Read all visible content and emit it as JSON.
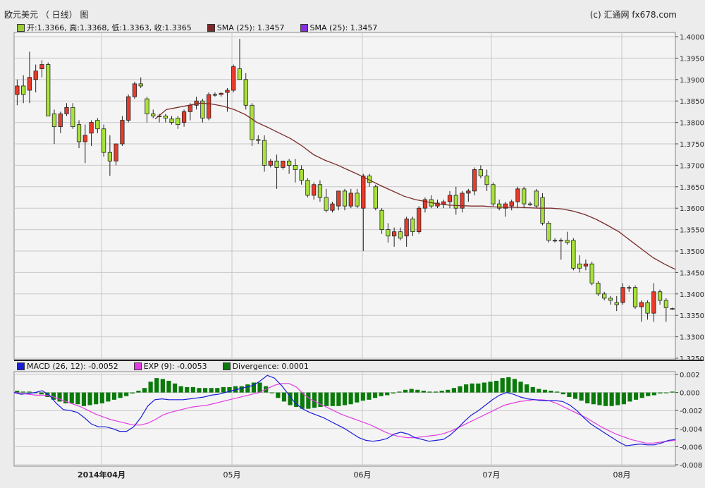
{
  "header": {
    "title": "欧元美元 （ 日线） 图",
    "copyright": "(c) 汇通网 fx678.com"
  },
  "legend_top": [
    {
      "label": "开:1.3366, 高:1.3368, 低:1.3363, 收:1.3365",
      "color": "#9acd32"
    },
    {
      "label": "SMA (25): 1.3457",
      "color": "#7a2a2a"
    },
    {
      "label": "SMA (25): 1.3457",
      "color": "#8a2be2"
    }
  ],
  "legend_bottom": [
    {
      "label": "MACD (26, 12): -0.0052",
      "color": "#1a1adc"
    },
    {
      "label": "EXP (9): -0.0053",
      "color": "#e23ce2"
    },
    {
      "label": "Divergence: 0.0001",
      "color": "#0a7a0a"
    }
  ],
  "colors": {
    "up": "#e83a2a",
    "down": "#a8e23a",
    "sma": "#7a2a2a",
    "macd": "#1a1adc",
    "signal": "#e23ce2",
    "hist": "#0a7a0a",
    "grid": "#c8c8c8",
    "plot_bg": "#f4f4f4"
  },
  "chart_data": [
    {
      "type": "candlestick",
      "ylim": [
        1.325,
        1.4
      ],
      "yticks": [
        "1.4000",
        "1.3950",
        "1.3900",
        "1.3850",
        "1.3800",
        "1.3750",
        "1.3700",
        "1.3650",
        "1.3600",
        "1.3550",
        "1.3500",
        "1.3450",
        "1.3400",
        "1.3350",
        "1.3300",
        "1.3250"
      ],
      "xticks": [
        "2014年04月",
        "05月",
        "06月",
        "07月",
        "08月"
      ],
      "candles": [
        [
          1.3865,
          1.39,
          1.384,
          1.3885
        ],
        [
          1.3885,
          1.391,
          1.3845,
          1.3865
        ],
        [
          1.3875,
          1.3965,
          1.3845,
          1.3905
        ],
        [
          1.39,
          1.3935,
          1.387,
          1.392
        ],
        [
          1.3925,
          1.3945,
          1.3905,
          1.3935
        ],
        [
          1.3935,
          1.394,
          1.3815,
          1.3815
        ],
        [
          1.382,
          1.383,
          1.375,
          1.379
        ],
        [
          1.379,
          1.3825,
          1.3775,
          1.382
        ],
        [
          1.382,
          1.3845,
          1.3815,
          1.3835
        ],
        [
          1.3835,
          1.3845,
          1.3785,
          1.379
        ],
        [
          1.3795,
          1.3805,
          1.374,
          1.3755
        ],
        [
          1.3755,
          1.3795,
          1.3705,
          1.377
        ],
        [
          1.3775,
          1.3805,
          1.3745,
          1.38
        ],
        [
          1.3805,
          1.381,
          1.3775,
          1.3785
        ],
        [
          1.3785,
          1.3795,
          1.372,
          1.373
        ],
        [
          1.373,
          1.377,
          1.3675,
          1.371
        ],
        [
          1.371,
          1.3745,
          1.37,
          1.375
        ],
        [
          1.375,
          1.3815,
          1.3745,
          1.3805
        ],
        [
          1.3805,
          1.3865,
          1.38,
          1.386
        ],
        [
          1.386,
          1.3895,
          1.3855,
          1.389
        ],
        [
          1.389,
          1.3905,
          1.388,
          1.3885
        ],
        [
          1.3855,
          1.386,
          1.38,
          1.382
        ],
        [
          1.382,
          1.383,
          1.381,
          1.3815
        ],
        [
          1.3815,
          1.382,
          1.38,
          1.3815
        ],
        [
          1.3815,
          1.382,
          1.38,
          1.381
        ],
        [
          1.3808,
          1.3815,
          1.3795,
          1.38
        ],
        [
          1.381,
          1.3815,
          1.3785,
          1.3795
        ],
        [
          1.38,
          1.383,
          1.379,
          1.3825
        ],
        [
          1.3825,
          1.3845,
          1.3805,
          1.384
        ],
        [
          1.384,
          1.386,
          1.383,
          1.385
        ],
        [
          1.385,
          1.3855,
          1.38,
          1.381
        ],
        [
          1.381,
          1.387,
          1.3805,
          1.3865
        ],
        [
          1.3865,
          1.387,
          1.386,
          1.3865
        ],
        [
          1.3865,
          1.387,
          1.386,
          1.3868
        ],
        [
          1.387,
          1.388,
          1.3825,
          1.3875
        ],
        [
          1.3875,
          1.3935,
          1.387,
          1.393
        ],
        [
          1.3925,
          1.3995,
          1.391,
          1.39
        ],
        [
          1.39,
          1.3915,
          1.383,
          1.384
        ],
        [
          1.384,
          1.3845,
          1.3745,
          1.376
        ],
        [
          1.376,
          1.377,
          1.375,
          1.3758
        ],
        [
          1.3758,
          1.377,
          1.3685,
          1.37
        ],
        [
          1.37,
          1.3715,
          1.3695,
          1.371
        ],
        [
          1.371,
          1.3725,
          1.3645,
          1.3695
        ],
        [
          1.3695,
          1.371,
          1.369,
          1.371
        ],
        [
          1.371,
          1.3715,
          1.368,
          1.37
        ],
        [
          1.37,
          1.3715,
          1.366,
          1.369
        ],
        [
          1.369,
          1.37,
          1.3655,
          1.3665
        ],
        [
          1.3665,
          1.367,
          1.3625,
          1.363
        ],
        [
          1.363,
          1.366,
          1.362,
          1.3655
        ],
        [
          1.3655,
          1.3665,
          1.3615,
          1.3625
        ],
        [
          1.3625,
          1.3645,
          1.359,
          1.3595
        ],
        [
          1.3595,
          1.3615,
          1.359,
          1.361
        ],
        [
          1.3605,
          1.363,
          1.3595,
          1.364
        ],
        [
          1.364,
          1.3645,
          1.3595,
          1.3605
        ],
        [
          1.3605,
          1.3645,
          1.36,
          1.3635
        ],
        [
          1.3635,
          1.3645,
          1.36,
          1.3605
        ],
        [
          1.36,
          1.368,
          1.35,
          1.3675
        ],
        [
          1.3675,
          1.368,
          1.365,
          1.366
        ],
        [
          1.365,
          1.3655,
          1.3595,
          1.36
        ],
        [
          1.3595,
          1.36,
          1.354,
          1.355
        ],
        [
          1.355,
          1.3565,
          1.352,
          1.3535
        ],
        [
          1.3535,
          1.3555,
          1.351,
          1.3545
        ],
        [
          1.3545,
          1.3555,
          1.3525,
          1.353
        ],
        [
          1.3535,
          1.358,
          1.351,
          1.3575
        ],
        [
          1.3575,
          1.358,
          1.3535,
          1.3545
        ],
        [
          1.3545,
          1.3605,
          1.354,
          1.36
        ],
        [
          1.36,
          1.3625,
          1.359,
          1.362
        ],
        [
          1.362,
          1.363,
          1.36,
          1.3605
        ],
        [
          1.3605,
          1.362,
          1.36,
          1.3612
        ],
        [
          1.361,
          1.362,
          1.36,
          1.3615
        ],
        [
          1.3615,
          1.364,
          1.36,
          1.363
        ],
        [
          1.363,
          1.365,
          1.3585,
          1.36
        ],
        [
          1.36,
          1.364,
          1.359,
          1.3635
        ],
        [
          1.3635,
          1.3645,
          1.3615,
          1.364
        ],
        [
          1.364,
          1.3695,
          1.363,
          1.369
        ],
        [
          1.369,
          1.37,
          1.367,
          1.3675
        ],
        [
          1.3675,
          1.369,
          1.364,
          1.3655
        ],
        [
          1.3655,
          1.366,
          1.3605,
          1.361
        ],
        [
          1.361,
          1.362,
          1.3595,
          1.36
        ],
        [
          1.36,
          1.3615,
          1.358,
          1.361
        ],
        [
          1.3605,
          1.362,
          1.3595,
          1.3615
        ],
        [
          1.3615,
          1.365,
          1.36,
          1.3645
        ],
        [
          1.3645,
          1.365,
          1.36,
          1.361
        ],
        [
          1.361,
          1.3615,
          1.3605,
          1.3608
        ],
        [
          1.364,
          1.3645,
          1.36,
          1.3605
        ],
        [
          1.3625,
          1.3635,
          1.356,
          1.3565
        ],
        [
          1.3565,
          1.357,
          1.352,
          1.3525
        ],
        [
          1.3525,
          1.353,
          1.352,
          1.3525
        ],
        [
          1.3525,
          1.353,
          1.348,
          1.3525
        ],
        [
          1.3525,
          1.3545,
          1.3515,
          1.352
        ],
        [
          1.3525,
          1.353,
          1.3455,
          1.346
        ],
        [
          1.347,
          1.349,
          1.345,
          1.346
        ],
        [
          1.3465,
          1.348,
          1.3455,
          1.347
        ],
        [
          1.347,
          1.3475,
          1.342,
          1.3425
        ],
        [
          1.3425,
          1.343,
          1.3395,
          1.34
        ],
        [
          1.34,
          1.3405,
          1.3385,
          1.339
        ],
        [
          1.339,
          1.3395,
          1.3375,
          1.3385
        ],
        [
          1.338,
          1.3395,
          1.336,
          1.3375
        ],
        [
          1.338,
          1.3425,
          1.3375,
          1.3415
        ],
        [
          1.3415,
          1.342,
          1.3405,
          1.3415
        ],
        [
          1.3415,
          1.342,
          1.3365,
          1.337
        ],
        [
          1.337,
          1.3385,
          1.3335,
          1.338
        ],
        [
          1.338,
          1.3385,
          1.334,
          1.3355
        ],
        [
          1.3355,
          1.3425,
          1.3335,
          1.3405
        ],
        [
          1.3405,
          1.341,
          1.3375,
          1.3385
        ],
        [
          1.3385,
          1.339,
          1.3335,
          1.3368
        ],
        [
          1.3366,
          1.3368,
          1.3363,
          1.3365
        ]
      ],
      "sma": [
        [
          1.3808,
          1.3808
        ],
        [
          1.381,
          1.383
        ],
        [
          1.3815,
          1.3835
        ],
        [
          1.382,
          1.384
        ],
        [
          1.383,
          1.3845
        ],
        [
          1.3835,
          1.3843
        ],
        [
          1.384,
          1.3838
        ],
        [
          1.3845,
          1.383
        ],
        [
          1.3848,
          1.3818
        ],
        [
          1.385,
          1.38
        ],
        [
          1.3853,
          1.3788
        ],
        [
          1.3856,
          1.3775
        ],
        [
          1.3858,
          1.3762
        ],
        [
          1.386,
          1.3745
        ],
        [
          1.3862,
          1.3725
        ],
        [
          1.3864,
          1.3712
        ],
        [
          1.3866,
          1.3702
        ],
        [
          1.3868,
          1.369
        ],
        [
          1.387,
          1.3678
        ],
        [
          1.3872,
          1.3665
        ],
        [
          1.3874,
          1.3652
        ],
        [
          1.3876,
          1.364
        ],
        [
          1.3878,
          1.3628
        ],
        [
          1.388,
          1.362
        ],
        [
          1.3882,
          1.3615
        ],
        [
          1.3884,
          1.361
        ],
        [
          1.3886,
          1.3607
        ],
        [
          1.3888,
          1.3606
        ],
        [
          1.389,
          1.3605
        ],
        [
          1.3892,
          1.3605
        ],
        [
          1.3894,
          1.3603
        ],
        [
          1.3896,
          1.3602
        ],
        [
          1.3898,
          1.3602
        ],
        [
          1.39,
          1.3601
        ],
        [
          1.3902,
          1.36
        ],
        [
          1.3904,
          1.36
        ],
        [
          1.3906,
          1.3598
        ],
        [
          1.3908,
          1.3593
        ],
        [
          1.391,
          1.3585
        ],
        [
          1.3912,
          1.3574
        ],
        [
          1.3914,
          1.356
        ],
        [
          1.3916,
          1.3545
        ],
        [
          1.3918,
          1.3525
        ],
        [
          1.392,
          1.3505
        ],
        [
          1.3922,
          1.3485
        ],
        [
          1.3924,
          1.347
        ],
        [
          1.3926,
          1.3457
        ]
      ],
      "sma_xfrac_note": "",
      "macd": [
        0.0,
        -0.0002,
        -0.0001,
        0.0,
        0.0002,
        -0.0003,
        -0.0012,
        -0.0019,
        -0.002,
        -0.0022,
        -0.0028,
        -0.0035,
        -0.0038,
        -0.0038,
        -0.004,
        -0.0043,
        -0.0043,
        -0.0038,
        -0.0028,
        -0.0015,
        -0.0008,
        -0.0007,
        -0.0008,
        -0.0008,
        -0.0008,
        -0.0007,
        -0.0006,
        -0.0005,
        -0.0003,
        -0.0002,
        0.0,
        0.0002,
        0.0004,
        0.0006,
        0.0008,
        0.0013,
        0.0019,
        0.0016,
        0.0008,
        -0.0002,
        -0.0012,
        -0.0018,
        -0.0022,
        -0.0025,
        -0.0028,
        -0.0032,
        -0.0036,
        -0.004,
        -0.0045,
        -0.005,
        -0.0053,
        -0.0054,
        -0.0053,
        -0.0051,
        -0.0046,
        -0.0044,
        -0.0046,
        -0.005,
        -0.0052,
        -0.0054,
        -0.0053,
        -0.0052,
        -0.0047,
        -0.004,
        -0.0032,
        -0.0025,
        -0.002,
        -0.0014,
        -0.0008,
        -0.0003,
        0.0,
        -0.0002,
        -0.0005,
        -0.0007,
        -0.0008,
        -0.0009,
        -0.0009,
        -0.0009,
        -0.001,
        -0.0014,
        -0.002,
        -0.0028,
        -0.0035,
        -0.004,
        -0.0045,
        -0.005,
        -0.0055,
        -0.0059,
        -0.0058,
        -0.0057,
        -0.0058,
        -0.0058,
        -0.0056,
        -0.0053,
        -0.0052
      ],
      "signal": [
        0.0,
        -0.0001,
        -0.0002,
        -0.0003,
        -0.0003,
        -0.0004,
        -0.0007,
        -0.001,
        -0.0013,
        -0.0016,
        -0.002,
        -0.0024,
        -0.0027,
        -0.003,
        -0.0032,
        -0.0034,
        -0.0036,
        -0.0036,
        -0.0034,
        -0.003,
        -0.0025,
        -0.0022,
        -0.002,
        -0.0018,
        -0.0016,
        -0.0015,
        -0.0014,
        -0.0012,
        -0.001,
        -0.0008,
        -0.0006,
        -0.0004,
        -0.0002,
        0.0,
        0.0004,
        0.0008,
        0.001,
        0.001,
        0.0006,
        -0.0002,
        -0.0008,
        -0.0012,
        -0.0016,
        -0.002,
        -0.0024,
        -0.0027,
        -0.003,
        -0.0033,
        -0.0036,
        -0.004,
        -0.0044,
        -0.0047,
        -0.0049,
        -0.005,
        -0.005,
        -0.0049,
        -0.0048,
        -0.0047,
        -0.0045,
        -0.0042,
        -0.0038,
        -0.0034,
        -0.003,
        -0.0026,
        -0.0022,
        -0.0018,
        -0.0014,
        -0.0012,
        -0.001,
        -0.0009,
        -0.0008,
        -0.0008,
        -0.0009,
        -0.0012,
        -0.0016,
        -0.002,
        -0.0024,
        -0.0028,
        -0.0033,
        -0.0038,
        -0.0042,
        -0.0046,
        -0.0049,
        -0.0052,
        -0.0054,
        -0.0056,
        -0.0056,
        -0.0055,
        -0.0054,
        -0.0053
      ],
      "hist": [
        0.0002,
        0.0001,
        0.0001,
        0.0,
        -0.0002,
        -0.0005,
        -0.0008,
        -0.001,
        -0.0012,
        -0.0012,
        -0.0013,
        -0.0015,
        -0.0014,
        -0.0013,
        -0.0012,
        -0.001,
        -0.0008,
        -0.0006,
        -0.0004,
        -0.0001,
        0.0002,
        0.0005,
        0.0012,
        0.0016,
        0.0015,
        0.0013,
        0.001,
        0.0007,
        0.0006,
        0.0006,
        0.0005,
        0.0005,
        0.0005,
        0.0005,
        0.0006,
        0.0006,
        0.0007,
        0.0007,
        0.0009,
        0.0011,
        0.0011,
        0.0007,
        0.0,
        -0.0006,
        -0.001,
        -0.0014,
        -0.0016,
        -0.0018,
        -0.0018,
        -0.0017,
        -0.0016,
        -0.0015,
        -0.0015,
        -0.0015,
        -0.0014,
        -0.0013,
        -0.0011,
        -0.0009,
        -0.0008,
        -0.0006,
        -0.0004,
        -0.0003,
        -0.0001,
        0.0001,
        0.0003,
        0.0004,
        0.0003,
        0.0002,
        0.0001,
        0.0001,
        0.0002,
        0.0003,
        0.0005,
        0.0007,
        0.0009,
        0.001,
        0.001,
        0.0011,
        0.0012,
        0.0013,
        0.0016,
        0.0017,
        0.0015,
        0.0012,
        0.0009,
        0.0006,
        0.0004,
        0.0003,
        0.0002,
        0.0001,
        -0.0002,
        -0.0005,
        -0.0007,
        -0.0009,
        -0.0012,
        -0.0013,
        -0.0014,
        -0.0015,
        -0.0015,
        -0.0014,
        -0.0013,
        -0.001,
        -0.0008,
        -0.0006,
        -0.0004,
        -0.0003,
        -0.0001,
        0.0,
        0.0001
      ],
      "macd_ylim": [
        -0.008,
        0.002
      ],
      "macd_yticks": [
        "0.002",
        "0.000",
        "-0.002",
        "-0.004",
        "-0.006",
        "-0.008"
      ]
    }
  ]
}
